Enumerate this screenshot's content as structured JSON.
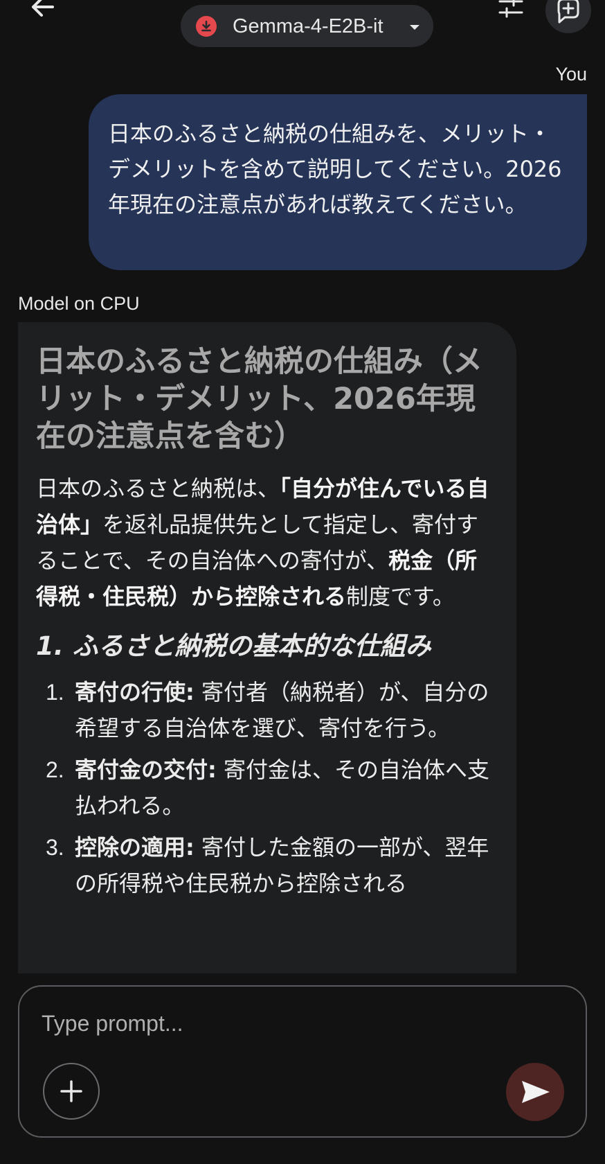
{
  "header": {
    "model_name": "Gemma-4-E2B-it"
  },
  "chat": {
    "user_label": "You",
    "user_message": "日本のふるさと納税の仕組みを、メリット・デメリットを含めて説明してください。2026年現在の注意点があれば教えてください。",
    "model_label": "Model on CPU",
    "response": {
      "title": "日本のふるさと納税の仕組み（メリット・デメリット、2026年現在の注意点を含む）",
      "intro": {
        "p1": "日本のふるさと納税は、",
        "b1": "「自分が住んでいる自治体」",
        "p2": "を返礼品提供先として指定し、寄付することで、その自治体への寄付が、",
        "b2": "税金（所得税・住民税）から控除される",
        "p3": "制度です。"
      },
      "section1_heading": "1. ふるさと納税の基本的な仕組み",
      "list": [
        {
          "num": "1.",
          "bold": "寄付の行使:",
          "text": " 寄付者（納税者）が、自分の希望する自治体を選び、寄付を行う。"
        },
        {
          "num": "2.",
          "bold": "寄付金の交付:",
          "text": " 寄付金は、その自治体へ支払われる。"
        },
        {
          "num": "3.",
          "bold": "控除の適用:",
          "text": " 寄付した金額の一部が、翌年の所得税や住民税から控除される"
        }
      ]
    }
  },
  "input": {
    "placeholder": "Type prompt..."
  },
  "icons": {
    "back": "arrow-back-icon",
    "download": "download-icon",
    "caret": "caret-down-icon",
    "tune": "tune-icon",
    "new_chat": "new-chat-icon",
    "add": "plus-icon",
    "send": "send-icon"
  },
  "colors": {
    "background": "#121212",
    "user_bubble": "#253457",
    "model_bubble": "#1e1f21",
    "download_red": "#e5484d",
    "send_button": "#4e2522"
  }
}
